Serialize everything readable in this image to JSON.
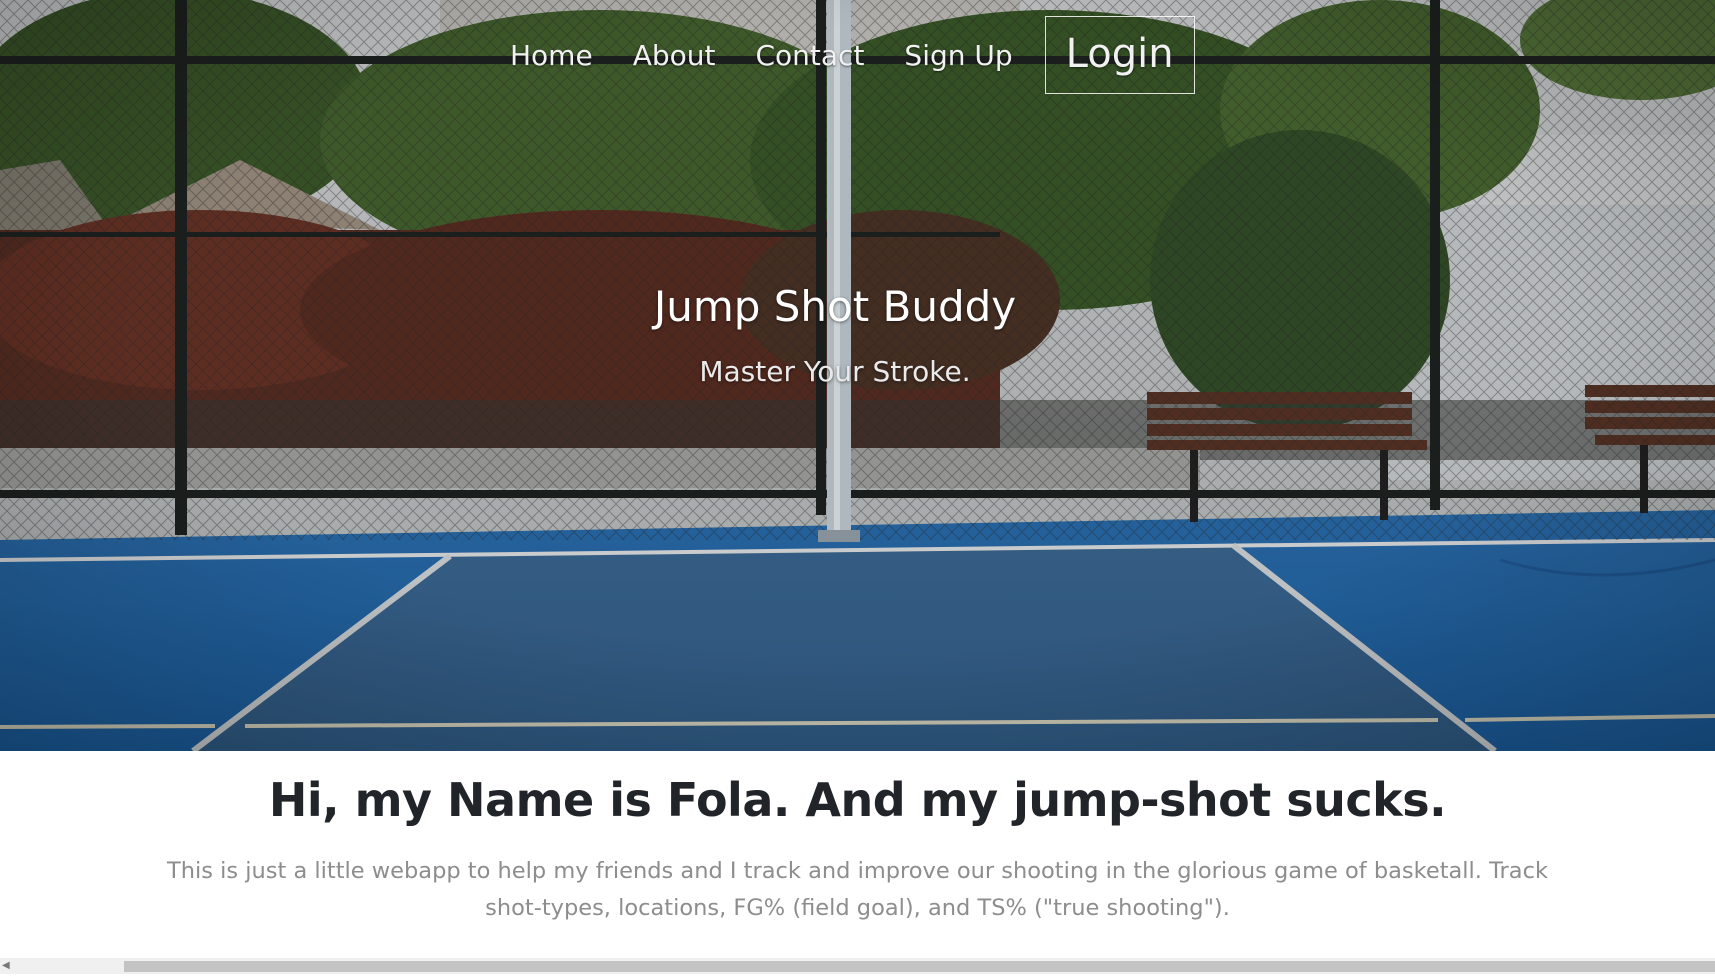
{
  "nav": {
    "home": "Home",
    "about": "About",
    "contact": "Contact",
    "signup": "Sign Up",
    "login": "Login"
  },
  "hero": {
    "title": "Jump Shot Buddy",
    "subtitle": "Master Your Stroke."
  },
  "intro": {
    "heading": "Hi, my Name is Fola. And my jump-shot sucks.",
    "body": "This is just a little webapp to help my friends and I track and improve our shooting in the glorious game of basketall. Track shot-types, locations, FG% (field goal), and TS% (\"true shooting\")."
  },
  "colors": {
    "court_blue": "#1f6fb5",
    "heading_text": "#212529",
    "body_text": "#8d8d8d"
  },
  "scrollbar": {
    "left_arrow_icon": "triangle-left-icon"
  }
}
